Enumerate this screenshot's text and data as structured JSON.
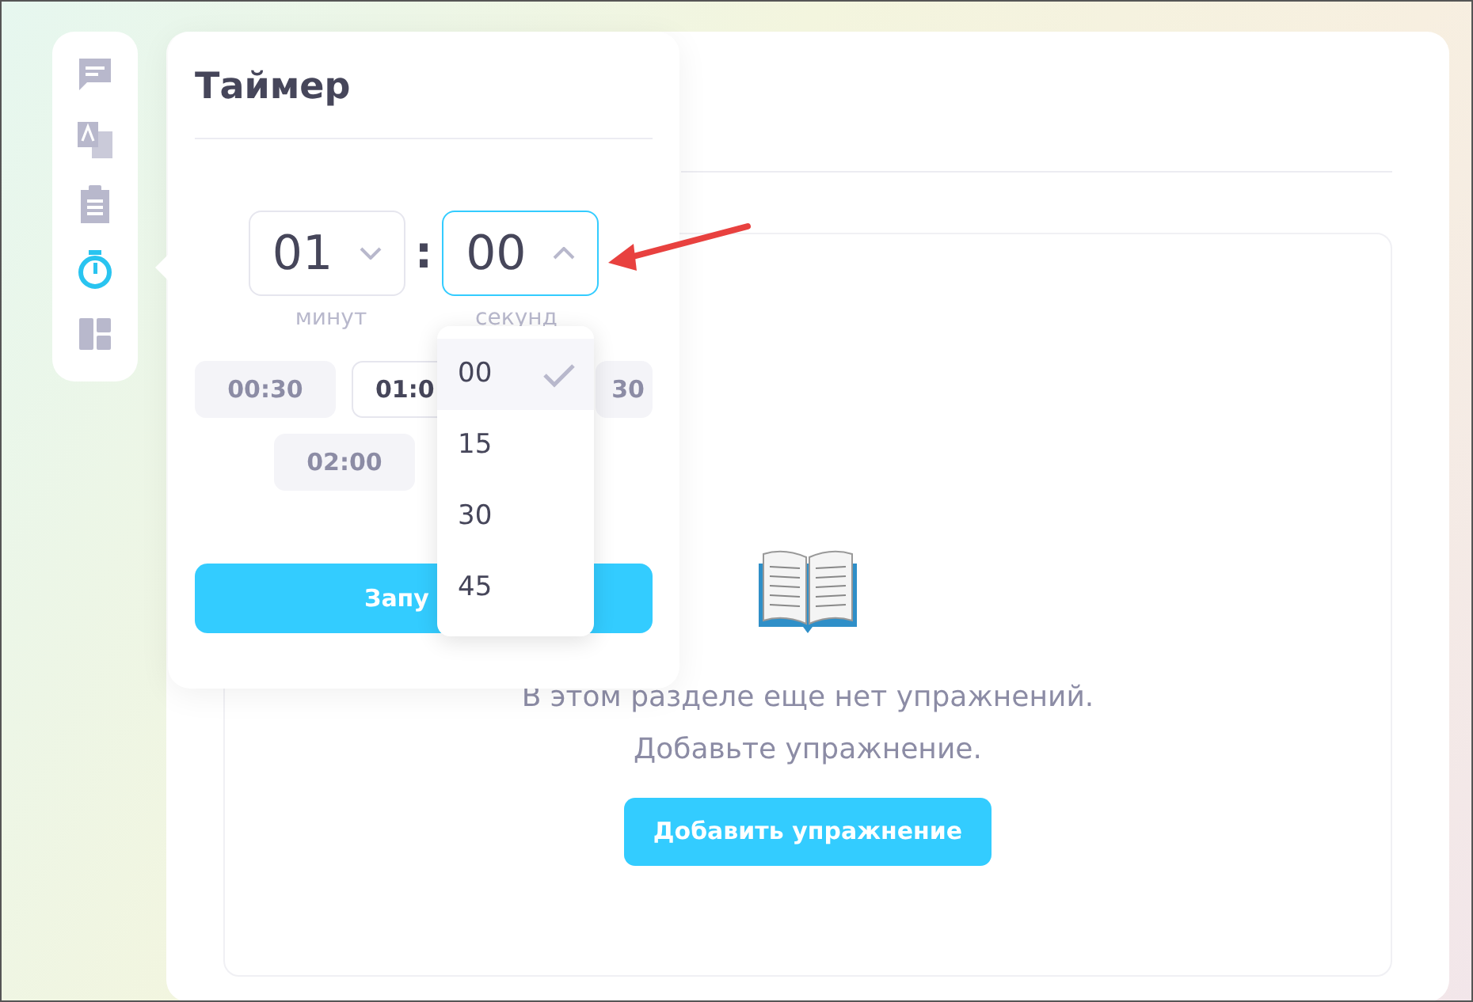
{
  "sidebar": {
    "items": [
      {
        "kind": "chat",
        "selected": false
      },
      {
        "kind": "translate",
        "selected": false
      },
      {
        "kind": "clipboard",
        "selected": false
      },
      {
        "kind": "timer",
        "selected": true
      },
      {
        "kind": "layout",
        "selected": false
      }
    ]
  },
  "timer": {
    "title": "Таймер",
    "minutes": {
      "value": "01",
      "label": "минут",
      "open": false
    },
    "separator": ":",
    "seconds": {
      "value": "00",
      "label": "секунд",
      "open": true,
      "options": [
        {
          "label": "00",
          "selected": true
        },
        {
          "label": "15",
          "selected": false
        },
        {
          "label": "30",
          "selected": false
        },
        {
          "label": "45",
          "selected": false
        }
      ]
    },
    "preset_rows": [
      [
        {
          "label": "00:30",
          "selected": false,
          "kind": "full"
        },
        {
          "label": "01:0",
          "selected": true,
          "kind": "cut_right"
        },
        {
          "label": "30",
          "selected": false,
          "kind": "cut_left"
        }
      ],
      [
        {
          "label": "02:00",
          "selected": false,
          "kind": "full"
        }
      ]
    ],
    "start_button": "Запу"
  },
  "empty_state": {
    "message": "В этом разделе еще нет упражнений.",
    "hint": "Добавьте упражнение.",
    "button": "Добавить упражнение"
  }
}
